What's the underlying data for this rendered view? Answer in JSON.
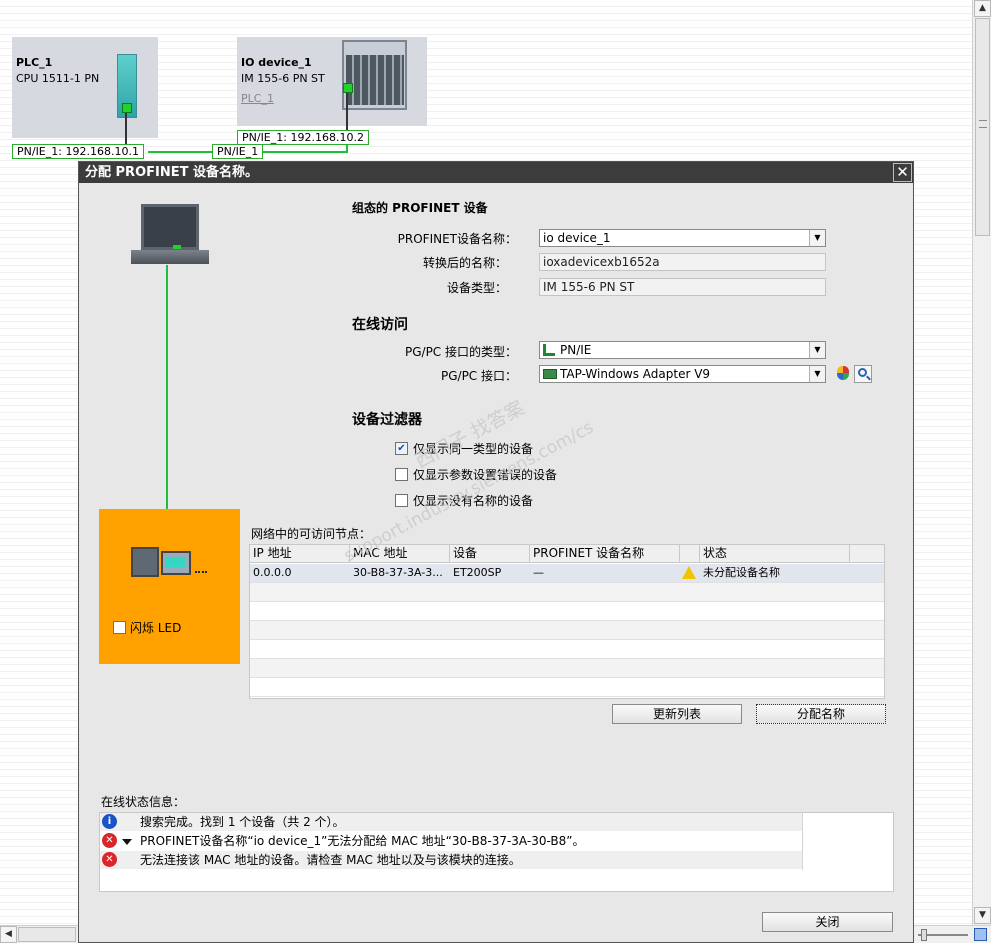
{
  "network": {
    "plc": {
      "name": "PLC_1",
      "model": "CPU 1511-1 PN",
      "ip_label": "PN/IE_1: 192.168.10.1"
    },
    "io_device": {
      "name": "IO device_1",
      "model": "IM 155-6 PN ST",
      "link": "PLC_1",
      "ip_label": "PN/IE_1: 192.168.10.2"
    },
    "subnet_label": "PN/IE_1"
  },
  "dialog": {
    "title": "分配 PROFINET 设备名称。",
    "close_glyph": "✕",
    "configured_section": "组态的 PROFINET 设备",
    "fields": {
      "device_name_label": "PROFINET设备名称：",
      "device_name_value": "io device_1",
      "converted_label": "转换后的名称：",
      "converted_value": "ioxadevicexb1652a",
      "type_label": "设备类型：",
      "type_value": "IM 155-6 PN ST"
    },
    "online_section": "在线访问",
    "pgpc_type_label": "PG/PC 接口的类型：",
    "pgpc_type_value": "PN/IE",
    "pgpc_iface_label": "PG/PC 接口：",
    "pgpc_iface_value": "TAP-Windows Adapter V9",
    "filter_section": "设备过滤器",
    "filters": [
      {
        "label": "仅显示同一类型的设备",
        "checked": true
      },
      {
        "label": "仅显示参数设置错误的设备",
        "checked": false
      },
      {
        "label": "仅显示没有名称的设备",
        "checked": false
      }
    ],
    "flash_led_label": "闪烁 LED",
    "nodes_label": "网络中的可访问节点：",
    "table": {
      "headers": [
        "IP 地址",
        "MAC 地址",
        "设备",
        "PROFINET 设备名称",
        "",
        "状态"
      ],
      "rows": [
        {
          "ip": "0.0.0.0",
          "mac": "30-B8-37-3A-3...",
          "device": "ET200SP",
          "name": "—",
          "status": "未分配设备名称"
        }
      ]
    },
    "refresh_button": "更新列表",
    "assign_button": "分配名称",
    "status_label": "在线状态信息：",
    "messages": [
      {
        "type": "info",
        "text": "搜索完成。找到 1 个设备（共 2 个）。"
      },
      {
        "type": "error",
        "text": "PROFINET设备名称“io device_1”无法分配给 MAC 地址“30-B8-37-3A-30-B8”。"
      },
      {
        "type": "error",
        "text": "无法连接该 MAC 地址的设备。请检查 MAC 地址以及与该模块的连接。"
      }
    ],
    "close_button": "关闭"
  },
  "watermark": {
    "line1": "西门子 找答案",
    "line2": "support.industry.siemens.com/cs"
  },
  "colors": {
    "accent_green": "#1fbf3a",
    "orange_panel": "#ffa200",
    "title_bar": "#3c3c3c"
  }
}
